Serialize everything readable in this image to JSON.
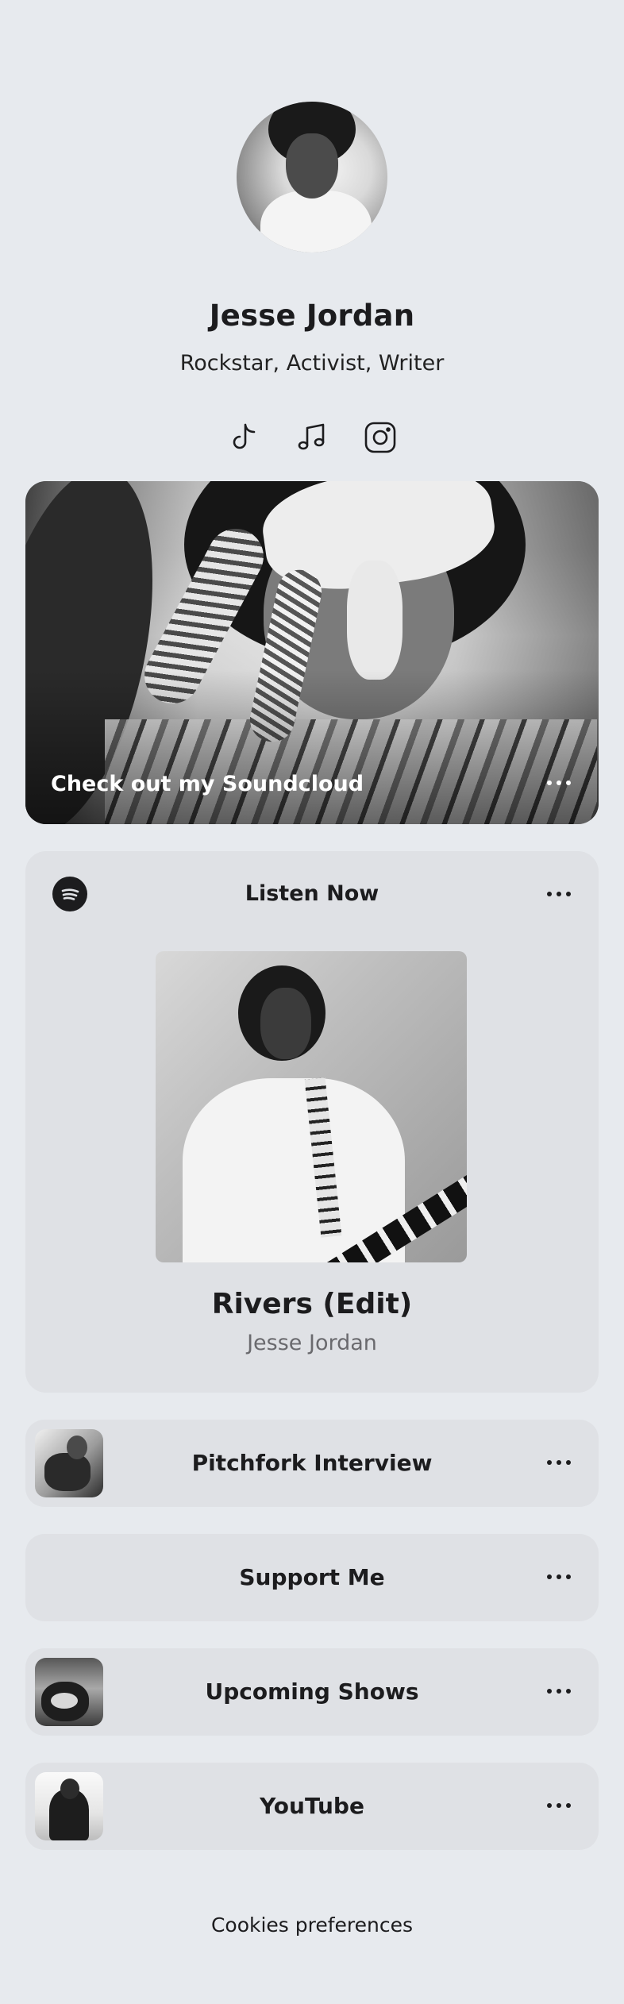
{
  "profile": {
    "name": "Jesse Jordan",
    "bio": "Rockstar, Activist, Writer",
    "avatar_icon": "profile-photo"
  },
  "socials": [
    {
      "icon": "tiktok-icon"
    },
    {
      "icon": "music-note-icon"
    },
    {
      "icon": "instagram-icon"
    }
  ],
  "feature_card": {
    "label": "Check out my Soundcloud",
    "more_icon": "more-icon"
  },
  "music_card": {
    "title": "Listen Now",
    "service_icon": "spotify-icon",
    "track": "Rivers (Edit)",
    "artist": "Jesse Jordan"
  },
  "links": [
    {
      "label": "Pitchfork Interview",
      "has_thumb": true
    },
    {
      "label": "Support Me",
      "has_thumb": false
    },
    {
      "label": "Upcoming Shows",
      "has_thumb": true
    },
    {
      "label": "YouTube",
      "has_thumb": true
    }
  ],
  "footer": {
    "cookies": "Cookies preferences"
  },
  "colors": {
    "background": "#e7eaee",
    "card": "#dfe1e5",
    "text": "#1c1c1e",
    "muted": "#6a6a6e"
  }
}
